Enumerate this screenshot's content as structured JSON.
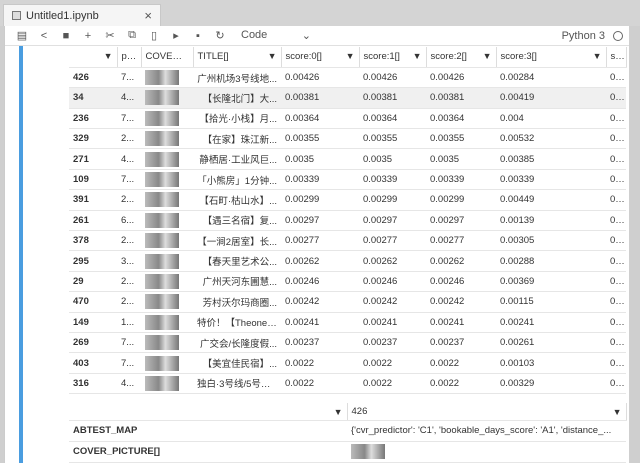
{
  "tab": {
    "title": "Untitled1.ipynb"
  },
  "toolbar": {
    "cell_type": "Code",
    "kernel": "Python 3"
  },
  "table": {
    "columns": [
      "",
      "pAb",
      "COVER_PI",
      "TITLE[]",
      "score:0[]",
      "score:1[]",
      "score:2[]",
      "score:3[]",
      "sco"
    ],
    "rows": [
      [
        "426",
        "7...",
        "",
        "广州机场3号线地...",
        "0.00426",
        "0.00426",
        "0.00426",
        "0.00284",
        "0.00"
      ],
      [
        "34",
        "4...",
        "",
        "【长隆北门】大...",
        "0.00381",
        "0.00381",
        "0.00381",
        "0.00419",
        "0.00"
      ],
      [
        "236",
        "7...",
        "",
        "【拾光·小栈】月...",
        "0.00364",
        "0.00364",
        "0.00364",
        "0.004",
        "0.00"
      ],
      [
        "329",
        "2...",
        "",
        "【在家】珠江新...",
        "0.00355",
        "0.00355",
        "0.00355",
        "0.00532",
        "0.00"
      ],
      [
        "271",
        "4...",
        "",
        "静栖居·工业风巨...",
        "0.0035",
        "0.0035",
        "0.0035",
        "0.00385",
        "0.00"
      ],
      [
        "109",
        "7...",
        "",
        "「小熊房」1分钟...",
        "0.00339",
        "0.00339",
        "0.00339",
        "0.00339",
        "0.00"
      ],
      [
        "391",
        "2...",
        "",
        "【石町·枯山水】...",
        "0.00299",
        "0.00299",
        "0.00299",
        "0.00449",
        "0.00"
      ],
      [
        "261",
        "6...",
        "",
        "【遇三名宿】复...",
        "0.00297",
        "0.00297",
        "0.00297",
        "0.00139",
        "0.00"
      ],
      [
        "378",
        "2...",
        "",
        "【一涧2居室】长...",
        "0.00277",
        "0.00277",
        "0.00277",
        "0.00305",
        "0.00"
      ],
      [
        "295",
        "3...",
        "",
        "【春天里艺术公...",
        "0.00262",
        "0.00262",
        "0.00262",
        "0.00288",
        "0.00"
      ],
      [
        "29",
        "2...",
        "",
        "广州天河东圃慧...",
        "0.00246",
        "0.00246",
        "0.00246",
        "0.00369",
        "0.00"
      ],
      [
        "470",
        "2...",
        "",
        "芳村沃尔玛商圈...",
        "0.00242",
        "0.00242",
        "0.00242",
        "0.00115",
        "0.00"
      ],
      [
        "149",
        "1...",
        "",
        "特价！【Theone....",
        "0.00241",
        "0.00241",
        "0.00241",
        "0.00241",
        "0.00"
      ],
      [
        "269",
        "7...",
        "",
        "广交会/长隆度假...",
        "0.00237",
        "0.00237",
        "0.00237",
        "0.00261",
        "0.00"
      ],
      [
        "403",
        "7...",
        "",
        "【美宜佳民宿】...",
        "0.0022",
        "0.0022",
        "0.0022",
        "0.00103",
        "0.00"
      ],
      [
        "316",
        "4...",
        "",
        "独白·3号线/5号线...",
        "0.0022",
        "0.0022",
        "0.0022",
        "0.00329",
        "0.00"
      ]
    ]
  },
  "detail": {
    "header": [
      "",
      "426"
    ],
    "rows": [
      [
        "ABTEST_MAP",
        "{'cvr_predictor': 'C1', 'bookable_days_score': 'A1', 'distance_..."
      ],
      [
        "COVER_PICTURE[]",
        ""
      ]
    ]
  }
}
